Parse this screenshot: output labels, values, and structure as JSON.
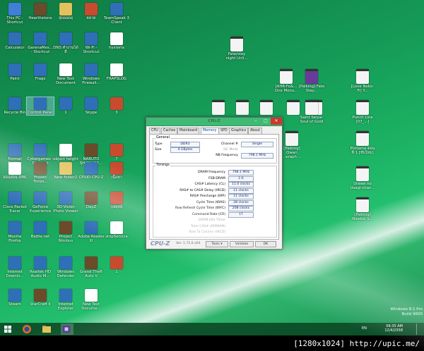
{
  "desktop": {
    "icons": [
      {
        "label": "This PC - Shortcut",
        "kind": "pc"
      },
      {
        "label": "Hearthstone",
        "kind": "game"
      },
      {
        "label": "สุดยอดยุ",
        "kind": "folder"
      },
      {
        "label": "ตลาด",
        "kind": "img"
      },
      {
        "label": "TeamSpeak 3 Client",
        "kind": "app"
      },
      {
        "label": "Calculator",
        "kind": "app"
      },
      {
        "label": "GarenaMes... - Shortcut",
        "kind": "app"
      },
      {
        "label": "DNS ทำงานได้ดี",
        "kind": "app"
      },
      {
        "label": "Wi-Fi - Shortcut",
        "kind": "app"
      },
      {
        "label": "hysteria",
        "kind": "doc"
      },
      {
        "label": "Paint",
        "kind": "app"
      },
      {
        "label": "Frags",
        "kind": "app"
      },
      {
        "label": "New Text Document",
        "kind": "doc"
      },
      {
        "label": "Windows Firewall...",
        "kind": "app"
      },
      {
        "label": "FRAPSLOG",
        "kind": "doc"
      },
      {
        "label": "Recycle Bin",
        "kind": "app"
      },
      {
        "label": "Control Panel",
        "kind": "app"
      },
      {
        "label": "1",
        "kind": "app"
      },
      {
        "label": "Skype",
        "kind": "app"
      },
      {
        "label": "3",
        "kind": "img"
      },
      {
        "label": "Format Factory",
        "kind": "app"
      },
      {
        "label": "Cybergames - Shortcut",
        "kind": "app"
      },
      {
        "label": "object height",
        "kind": "doc"
      },
      {
        "label": "NARUTO SHIPPUDE...",
        "kind": "game"
      },
      {
        "label": "7",
        "kind": "img"
      },
      {
        "label": "ลอนสอน XML",
        "kind": "doc"
      },
      {
        "label": "Frozen Thron...",
        "kind": "game"
      },
      {
        "label": "New folder2",
        "kind": "folder"
      },
      {
        "label": "CPUID CPU-Z",
        "kind": "app"
      },
      {
        "label": "เนื้อหา",
        "kind": "img"
      },
      {
        "label": "Cisco Packet Tracer",
        "kind": "app"
      },
      {
        "label": "GeForce Experience",
        "kind": "app"
      },
      {
        "label": "3D Vision Photo Viewer",
        "kind": "app"
      },
      {
        "label": "DayZ",
        "kind": "game"
      },
      {
        "label": "กลยุทธ์",
        "kind": "img"
      },
      {
        "label": "Mozilla Firefox",
        "kind": "app"
      },
      {
        "label": "Battle.net",
        "kind": "app"
      },
      {
        "label": "Project Nimbus",
        "kind": "game"
      },
      {
        "label": "Adobe Reader XI",
        "kind": "app"
      },
      {
        "label": "stopService",
        "kind": "doc"
      },
      {
        "label": "Internet Downlo...",
        "kind": "app"
      },
      {
        "label": "Realtek HD Audio M...",
        "kind": "app"
      },
      {
        "label": "Windows Defender",
        "kind": "app"
      },
      {
        "label": "Grand Theft Auto V",
        "kind": "game"
      },
      {
        "label": "1",
        "kind": "img"
      },
      {
        "label": "Steam",
        "kind": "app"
      },
      {
        "label": "StarCraft II",
        "kind": "game"
      },
      {
        "label": "Internet Explorer",
        "kind": "app"
      },
      {
        "label": "New Text Docume...",
        "kind": "doc"
      }
    ],
    "media_icons": [
      {
        "label": "Fate/stay night Unli...",
        "kind": "mkv"
      },
      {
        "label": "[AHR-Fo&... One Mono...",
        "kind": "mkv"
      },
      {
        "label": "[Paiking] Fate Stay...",
        "kind": "rar"
      },
      {
        "label": "[Love Neko-Fi] Y...",
        "kind": "mkv"
      },
      {
        "label": "",
        "kind": "mkv"
      },
      {
        "label": "",
        "kind": "mkv"
      },
      {
        "label": "",
        "kind": "mkv"
      },
      {
        "label": "",
        "kind": "mkv"
      },
      {
        "label": "",
        "kind": "mkv"
      },
      {
        "label": "Saint Seiya- Soul of Gold",
        "kind": "mkv"
      },
      {
        "label": "Punch Line [07_...]",
        "kind": "mkv"
      },
      {
        "label": "[Paiking] Owari ...eraph ...",
        "kind": "mkv"
      },
      {
        "label": "Etotama ตอน ที่ 1 [ซับไทย]",
        "kind": "mkv"
      },
      {
        "label": "Urawa no Usagi-chan...",
        "kind": "mkv"
      },
      {
        "label": "[Paiking] Nisekoi S...",
        "kind": "mkv"
      }
    ]
  },
  "cpuz": {
    "title": "CPU-Z",
    "tabs": [
      "CPU",
      "Caches",
      "Mainboard",
      "Memory",
      "SPD",
      "Graphics",
      "About"
    ],
    "active_tab": "Memory",
    "general": {
      "group": "General",
      "type_label": "Type",
      "type_value": "DDR3",
      "size_label": "Size",
      "size_value": "4 GBytes",
      "channel_label": "Channel #",
      "channel_value": "Single",
      "dc_mode_label": "DC Mode",
      "nb_freq_label": "NB Frequency",
      "nb_freq_value": "798.1 MHz"
    },
    "timings": {
      "group": "Timings",
      "rows": [
        {
          "label": "DRAM Frequency",
          "value": "798.1 MHz",
          "dim": false
        },
        {
          "label": "FSB:DRAM",
          "value": "1:6",
          "dim": false
        },
        {
          "label": "CAS# Latency (CL)",
          "value": "11.0 clocks",
          "dim": false
        },
        {
          "label": "RAS# to CAS# Delay (tRCD)",
          "value": "11 clocks",
          "dim": false
        },
        {
          "label": "RAS# Precharge (tRP)",
          "value": "11 clocks",
          "dim": false
        },
        {
          "label": "Cycle Time (tRAS)",
          "value": "28 clocks",
          "dim": false
        },
        {
          "label": "Row Refresh Cycle Time (tRFC)",
          "value": "208 clocks",
          "dim": false
        },
        {
          "label": "Command Rate (CR)",
          "value": "1T",
          "dim": false
        },
        {
          "label": "DRAM Idle Timer",
          "value": "",
          "dim": true
        },
        {
          "label": "Total CAS# (tRDRAM)",
          "value": "",
          "dim": true
        },
        {
          "label": "Row To Column (tRCD)",
          "value": "",
          "dim": true
        }
      ]
    },
    "footer": {
      "brand": "CPU-Z",
      "version": "Ver. 1.72.0.x64",
      "tools": "Tools",
      "validate": "Validate",
      "ok": "OK"
    }
  },
  "watermark": {
    "os": "Windows 8.1 Pro",
    "build": "Build 9600"
  },
  "taskbar": {
    "lang": "EN",
    "time": "06:35 AM",
    "date": "12/4/2558"
  },
  "footer_text": "[1280x1024] http://upic.me/",
  "colors": {
    "accent": "#1bb062",
    "titlebar": "#3fba74"
  }
}
